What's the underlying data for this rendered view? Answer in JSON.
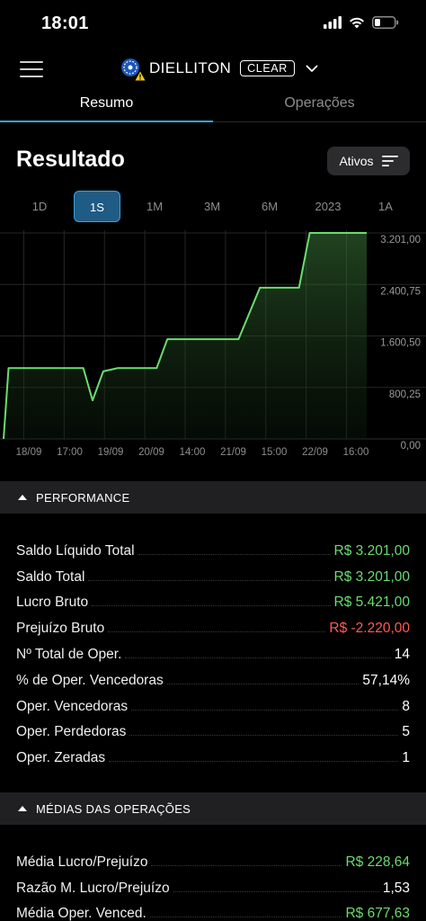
{
  "status_bar": {
    "time": "18:01"
  },
  "header": {
    "account_name": "DIELLITON",
    "broker": "CLEAR"
  },
  "tabs": [
    {
      "label": "Resumo",
      "active": true
    },
    {
      "label": "Operações",
      "active": false
    }
  ],
  "result": {
    "title": "Resultado",
    "filter_label": "Ativos"
  },
  "periods": [
    "1D",
    "1S",
    "1M",
    "3M",
    "6M",
    "2023",
    "1A"
  ],
  "selected_period": "1S",
  "chart_data": {
    "type": "area",
    "title": "",
    "xlabel": "",
    "ylabel": "",
    "x_tick_labels": [
      "18/09",
      "17:00",
      "19/09",
      "20/09",
      "14:00",
      "21/09",
      "15:00",
      "22/09",
      "16:00"
    ],
    "y_tick_labels": [
      "3.201,00",
      "2.400,75",
      "1.600,50",
      "800,25",
      "0,00"
    ],
    "ylim": [
      0,
      3201
    ],
    "grid": true,
    "line_color": "#6bdc6f",
    "series": [
      {
        "x": [
          0,
          0.07,
          0.55,
          1.0,
          1.12,
          1.25,
          1.4,
          1.6,
          2.0,
          2.15,
          2.3,
          2.6,
          3.0,
          3.3,
          3.6,
          4.0,
          4.15,
          4.3,
          4.7,
          5.0,
          5.1
        ],
        "values": [
          0,
          1100,
          1100,
          1100,
          1100,
          600,
          1050,
          1100,
          1100,
          1100,
          1550,
          1550,
          1550,
          1550,
          2350,
          2350,
          2350,
          3201,
          3201,
          3201,
          3201
        ]
      }
    ]
  },
  "performance": {
    "title": "PERFORMANCE",
    "rows": [
      {
        "label": "Saldo Líquido Total",
        "value": "R$ 3.201,00",
        "tone": "pos"
      },
      {
        "label": "Saldo Total",
        "value": "R$ 3.201,00",
        "tone": "pos"
      },
      {
        "label": "Lucro Bruto",
        "value": "R$ 5.421,00",
        "tone": "pos"
      },
      {
        "label": "Prejuízo Bruto",
        "value": "R$ -2.220,00",
        "tone": "neg"
      },
      {
        "label": "Nº Total de Oper.",
        "value": "14",
        "tone": "plain"
      },
      {
        "label": " % de Oper. Vencedoras",
        "value": "57,14%",
        "tone": "plain"
      },
      {
        "label": "Oper. Vencedoras",
        "value": "8",
        "tone": "plain"
      },
      {
        "label": "Oper. Perdedoras",
        "value": "5",
        "tone": "plain"
      },
      {
        "label": "Oper. Zeradas",
        "value": "1",
        "tone": "plain"
      }
    ]
  },
  "averages": {
    "title": "MÉDIAS DAS OPERAÇÕES",
    "rows": [
      {
        "label": "Média Lucro/Prejuízo",
        "value": "R$ 228,64",
        "tone": "pos"
      },
      {
        "label": "Razão M. Lucro/Prejuízo",
        "value": "1,53",
        "tone": "plain"
      },
      {
        "label": "Média Oper. Venced.",
        "value": "R$ 677,63",
        "tone": "pos"
      }
    ]
  },
  "colors": {
    "background": "#000000",
    "accent": "#3aa0d8",
    "positive": "#6bdc6f",
    "negative": "#ff5c55",
    "section_bg": "#202022"
  },
  "icons": [
    "signal-icon",
    "wifi-icon",
    "battery-icon",
    "hamburger-menu-icon",
    "account-avatar-icon",
    "warning-icon",
    "chevron-down-icon",
    "filter-icon",
    "caret-up-icon"
  ]
}
